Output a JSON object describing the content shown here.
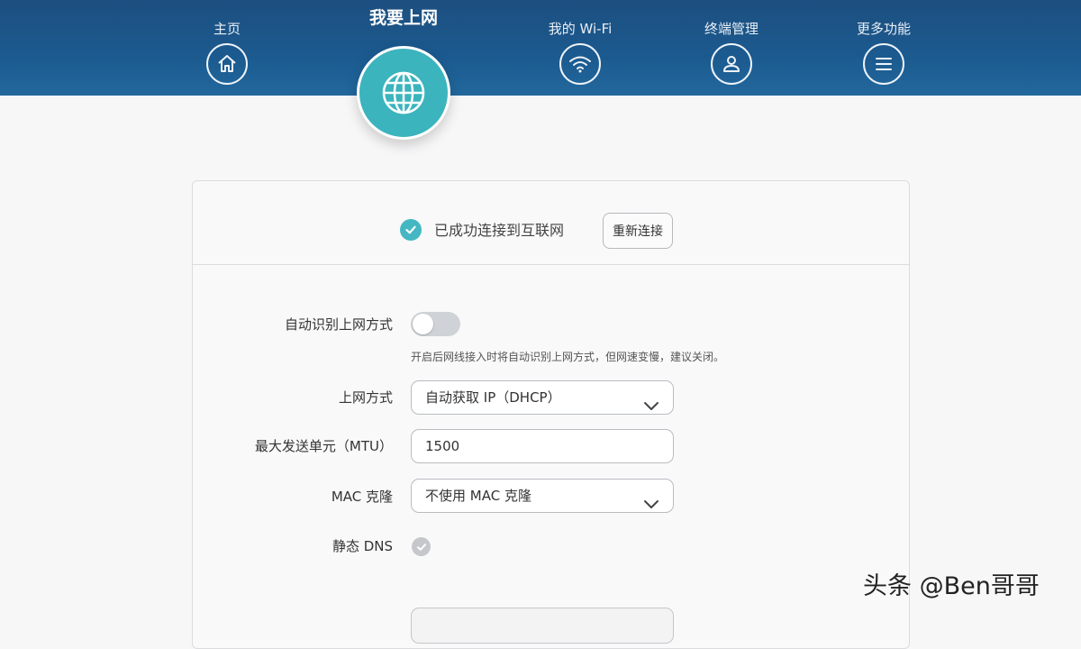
{
  "nav": {
    "home": "主页",
    "internet": "我要上网",
    "wifi": "我的 Wi-Fi",
    "devices": "终端管理",
    "more": "更多功能"
  },
  "status": {
    "text": "已成功连接到互联网",
    "reconnect_label": "重新连接",
    "accent": "#45b7c2"
  },
  "form": {
    "auto_detect_label": "自动识别上网方式",
    "auto_detect_on": false,
    "auto_detect_hint": "开启后网线接入时将自动识别上网方式，但网速变慢，建议关闭。",
    "method_label": "上网方式",
    "method_value": "自动获取 IP（DHCP）",
    "mtu_label": "最大发送单元（MTU）",
    "mtu_value": "1500",
    "mac_label": "MAC 克隆",
    "mac_value": "不使用 MAC 克隆",
    "dns_label": "静态 DNS"
  },
  "watermark": "头条 @Ben哥哥",
  "colors": {
    "header": "#1d4f80",
    "active_tab": "#3bb4bd"
  }
}
